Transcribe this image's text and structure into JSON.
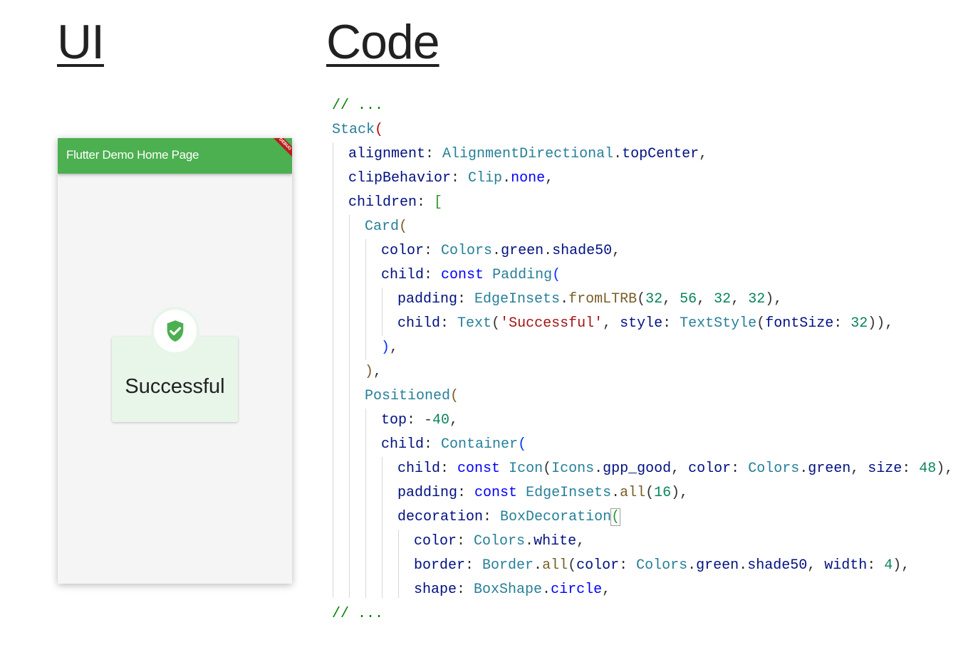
{
  "headings": {
    "ui": "UI",
    "code": "Code"
  },
  "app": {
    "title": "Flutter Demo Home Page",
    "debug_banner": "DEBUG",
    "card_text": "Successful",
    "icon": "gpp-good-shield-check-icon",
    "colors": {
      "primary": "#4caf50",
      "card_bg": "#e8f5e9",
      "icon": "#4caf50"
    }
  },
  "code": {
    "tokens": [
      "// ...",
      "Stack",
      "(",
      "alignment",
      ": ",
      "AlignmentDirectional",
      ".",
      "topCenter",
      ",",
      "clipBehavior",
      ": ",
      "Clip",
      ".",
      "none",
      ",",
      "children",
      ": ",
      "[",
      "Card",
      "(",
      "color",
      ": ",
      "Colors",
      ".",
      "green",
      ".",
      "shade50",
      ",",
      "child",
      ": ",
      "const",
      " ",
      "Padding",
      "(",
      "padding",
      ": ",
      "EdgeInsets",
      ".",
      "fromLTRB",
      "(",
      "32",
      ", ",
      "56",
      ", ",
      "32",
      ", ",
      "32",
      ")",
      ",",
      "child",
      ": ",
      "Text",
      "(",
      "'Successful'",
      ", ",
      "style",
      ": ",
      "TextStyle",
      "(",
      "fontSize",
      ": ",
      "32",
      ")",
      ")",
      ",",
      ")",
      ",",
      ")",
      ",",
      "Positioned",
      "(",
      "top",
      ": ",
      "-",
      "40",
      ",",
      "child",
      ": ",
      "Container",
      "(",
      "child",
      ": ",
      "const",
      " ",
      "Icon",
      "(",
      "Icons",
      ".",
      "gpp_good",
      ", ",
      "color",
      ": ",
      "Colors",
      ".",
      "green",
      ", ",
      "size",
      ": ",
      "48",
      ")",
      ",",
      "padding",
      ": ",
      "const",
      " ",
      "EdgeInsets",
      ".",
      "all",
      "(",
      "16",
      ")",
      ",",
      "decoration",
      ": ",
      "BoxDecoration",
      "(",
      "color",
      ": ",
      "Colors",
      ".",
      "white",
      ",",
      "border",
      ": ",
      "Border",
      ".",
      "all",
      "(",
      "color",
      ": ",
      "Colors",
      ".",
      "green",
      ".",
      "shade50",
      ", ",
      "width",
      ": ",
      "4",
      ")",
      ",",
      "shape",
      ": ",
      "BoxShape",
      ".",
      "circle",
      ",",
      "// ..."
    ]
  }
}
